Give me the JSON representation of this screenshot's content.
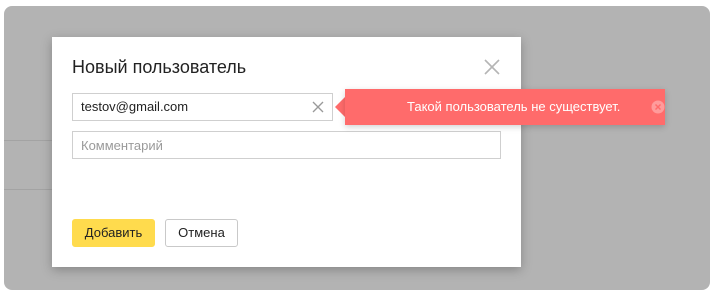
{
  "dialog": {
    "title": "Новый пользователь",
    "close_icon": "close-icon"
  },
  "user_field": {
    "value": "testov@gmail.com",
    "clear_icon": "clear-icon"
  },
  "comment_field": {
    "placeholder": "Комментарий",
    "value": ""
  },
  "buttons": {
    "add_label": "Добавить",
    "cancel_label": "Отмена"
  },
  "error": {
    "message": "Такой пользователь не существует.",
    "close_icon": "error-close-icon"
  },
  "colors": {
    "overlay": "#b3b3b3",
    "primary_button": "#ffdb4d",
    "error_background": "#ff6b6b",
    "error_text": "#ffffff"
  }
}
